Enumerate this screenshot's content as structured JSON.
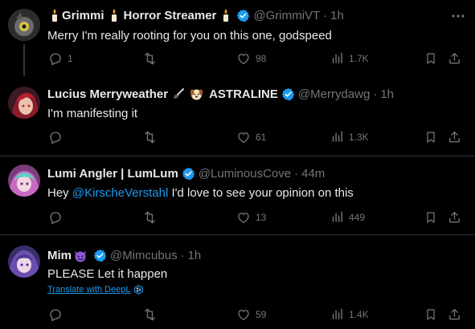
{
  "posts": [
    {
      "name_part1": "Grimmi",
      "name_part2": "Horror Streamer",
      "handle": "@GrimmiVT",
      "time": "1h",
      "text": "Merry I'm really rooting for you on this one, godspeed",
      "replies": "1",
      "likes": "98",
      "views": "1.7K"
    },
    {
      "name_part1": "Lucius Merryweather",
      "name_part2": "ASTRALINE",
      "handle": "@Merrydawg",
      "time": "1h",
      "text": "I'm manifesting it",
      "replies": "",
      "likes": "61",
      "views": "1.3K"
    },
    {
      "name": "Lumi Angler | LumLum",
      "handle": "@LuminousCove",
      "time": "44m",
      "text_before": "Hey ",
      "mention": "@KirscheVerstahl",
      "text_after": " I'd love to see your opinion on this",
      "replies": "",
      "likes": "13",
      "views": "449"
    },
    {
      "name": "Mim",
      "handle": "@Mimcubus",
      "time": "1h",
      "text": "PLEASE Let it happen",
      "translate": "Translate with DeepL",
      "replies": "",
      "likes": "59",
      "views": "1.4K"
    }
  ],
  "separator": "·",
  "colors": {
    "background": "#000000",
    "text": "#e7e9ea",
    "muted": "#71767b",
    "accent": "#1d9bf0",
    "divider": "#2f3336"
  },
  "icons": [
    "more-icon",
    "verified-icon",
    "reply-icon",
    "retweet-icon",
    "like-icon",
    "views-icon",
    "bookmark-icon",
    "share-icon",
    "candle-icon",
    "brush-icon",
    "dog-icon",
    "devil-icon",
    "deepl-icon"
  ]
}
